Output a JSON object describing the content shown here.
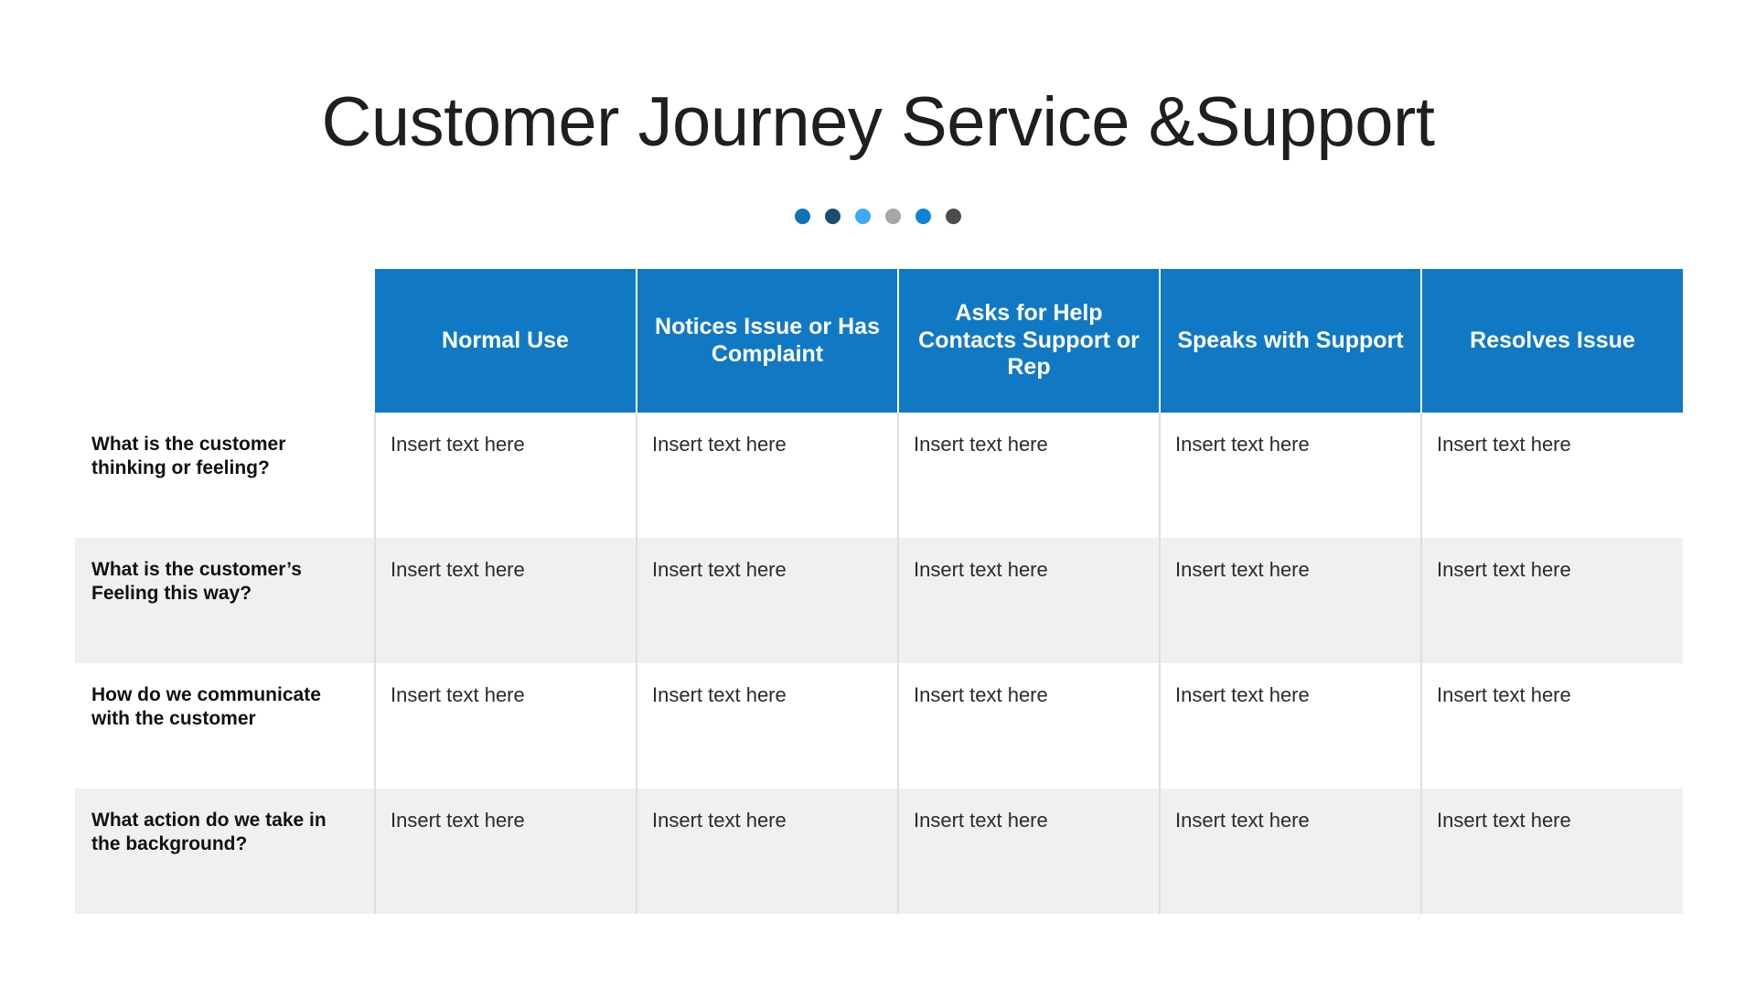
{
  "title": "Customer Journey Service &Support",
  "dots": [
    {
      "name": "dot-1",
      "color": "#1172b8"
    },
    {
      "name": "dot-2",
      "color": "#1c4d70"
    },
    {
      "name": "dot-3",
      "color": "#3fa9f5"
    },
    {
      "name": "dot-4",
      "color": "#a6a6a6"
    },
    {
      "name": "dot-5",
      "color": "#0c83d9"
    },
    {
      "name": "dot-6",
      "color": "#4d4d4d"
    }
  ],
  "table": {
    "header_bg": "#1179c4",
    "shaded_row_bg": "#f0f0f0",
    "corner_label": "",
    "stages": [
      "Normal Use",
      "Notices Issue or Has Complaint",
      "Asks for Help Contacts Support or Rep",
      "Speaks with Support",
      "Resolves Issue"
    ],
    "rows": [
      {
        "label": "What is the customer thinking or feeling?",
        "cells": [
          "Insert text here",
          "Insert text here",
          "Insert text here",
          "Insert text here",
          "Insert text here"
        ]
      },
      {
        "label": "What is the customer’s Feeling this way?",
        "cells": [
          "Insert text here",
          "Insert text here",
          "Insert text here",
          "Insert text here",
          "Insert text here"
        ]
      },
      {
        "label": "How do we communicate with the customer",
        "cells": [
          "Insert text here",
          "Insert text here",
          "Insert text here",
          "Insert text here",
          "Insert text here"
        ]
      },
      {
        "label": "What action do we take in the background?",
        "cells": [
          "Insert text here",
          "Insert text here",
          "Insert text here",
          "Insert text here",
          "Insert text here"
        ]
      }
    ]
  }
}
